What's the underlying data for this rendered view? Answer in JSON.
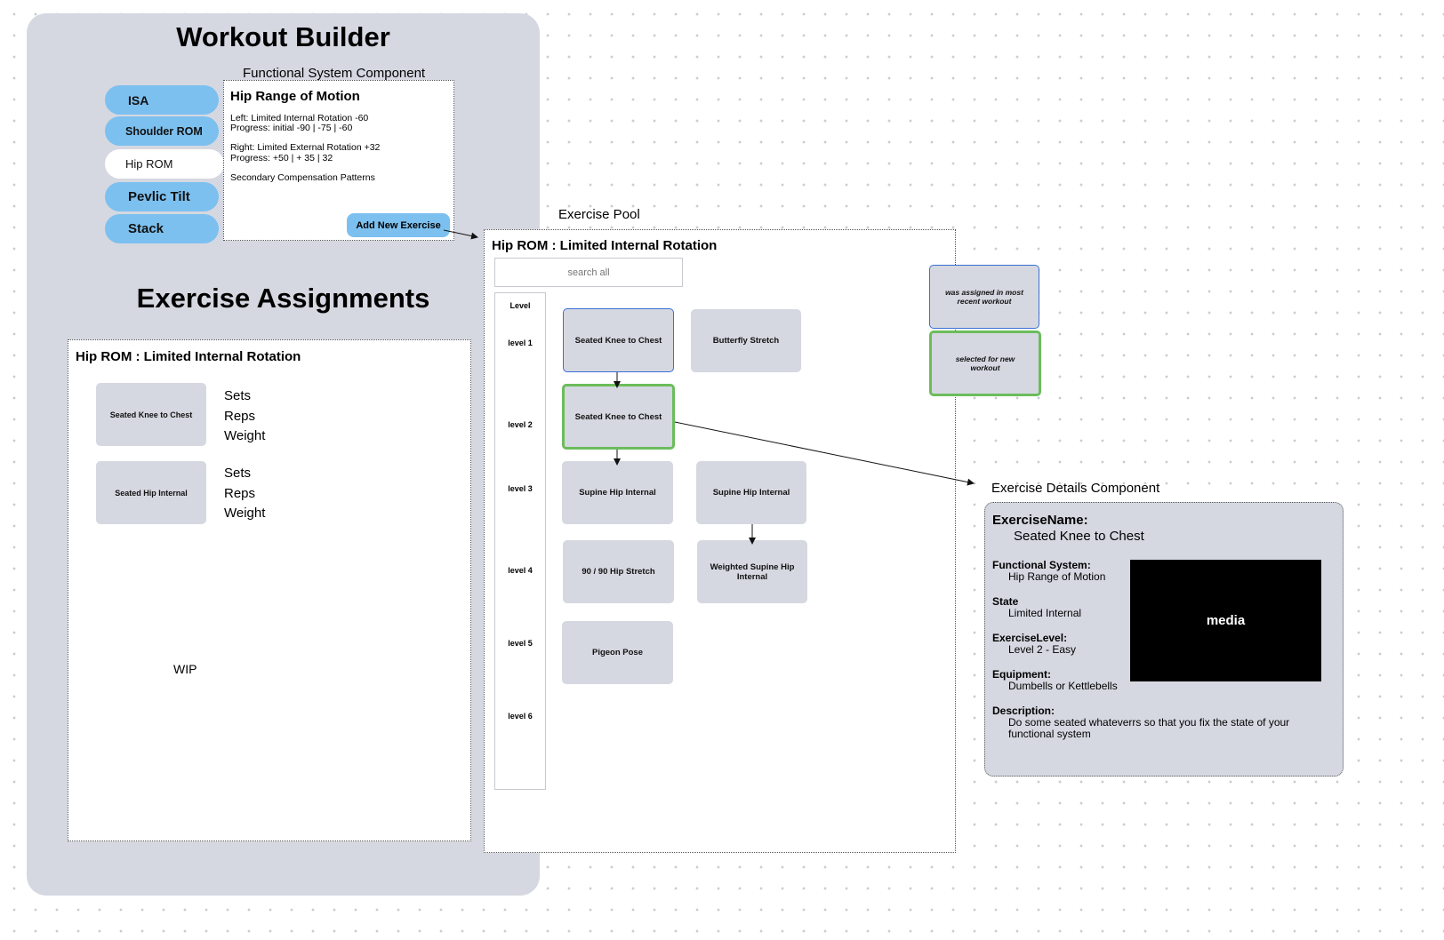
{
  "builder": {
    "title": "Workout Builder",
    "fs_component_label": "Functional System Component",
    "tabs": [
      {
        "label": "ISA"
      },
      {
        "label": "Shoulder ROM"
      },
      {
        "label": "Hip ROM"
      },
      {
        "label": "Pevlic Tilt"
      },
      {
        "label": "Stack"
      }
    ],
    "fs_card": {
      "heading": "Hip Range of Motion",
      "left_line1": "Left: Limited Internal Rotation -60",
      "left_line2": "Progress: initial -90 | -75 | -60",
      "right_line1": "Right: Limited External Rotation +32",
      "right_line2": "Progress: +50 | + 35 | 32",
      "secondary": "Secondary Compensation Patterns",
      "add_button": "Add New Exercise"
    },
    "assignments_title": "Exercise Assignments",
    "assignments": {
      "heading": "Hip ROM : Limited Internal Rotation",
      "items": [
        {
          "name": "Seated Knee to Chest",
          "fields": [
            "Sets",
            "Reps",
            "Weight"
          ]
        },
        {
          "name": "Seated Hip Internal",
          "fields": [
            "Sets",
            "Reps",
            "Weight"
          ]
        }
      ],
      "wip": "WIP"
    }
  },
  "pool": {
    "label": "Exercise Pool",
    "heading": "Hip ROM : Limited Internal Rotation",
    "search_placeholder": "search all",
    "level_header": "Level",
    "levels": [
      "level 1",
      "level 2",
      "level 3",
      "level 4",
      "level 5",
      "level 6"
    ],
    "tiles": {
      "l1a": "Seated Knee to Chest",
      "l1b": "Butterfly Stretch",
      "l2a": "Seated Knee to Chest",
      "l3a": "Supine Hip Internal",
      "l3b": "Supine Hip Internal",
      "l4a": "90 / 90 Hip Stretch",
      "l4b": "Weighted Supine Hip Internal",
      "l5a": "Pigeon Pose"
    }
  },
  "legend": {
    "assigned": "was assigned in most recent workout",
    "selected": "selected for new workout"
  },
  "details": {
    "label": "Exercise Details Component",
    "name_label": "ExerciseName:",
    "name_value": "Seated Knee to Chest",
    "fs_label": "Functional System:",
    "fs_value": "Hip Range of Motion",
    "state_label": "State",
    "state_value": "Limited Internal",
    "level_label": "ExerciseLevel:",
    "level_value": "Level 2 - Easy",
    "equipment_label": "Equipment:",
    "equipment_value": "Dumbells or Kettlebells",
    "desc_label": "Description:",
    "desc_value": "Do some seated whateverrs so that you fix the state of your functional system",
    "media": "media"
  },
  "colors": {
    "panel": "#d5d8e1",
    "tab": "#7cc0ef",
    "assigned_border": "#3a6fd6",
    "selected_border": "#6bbd5b"
  }
}
